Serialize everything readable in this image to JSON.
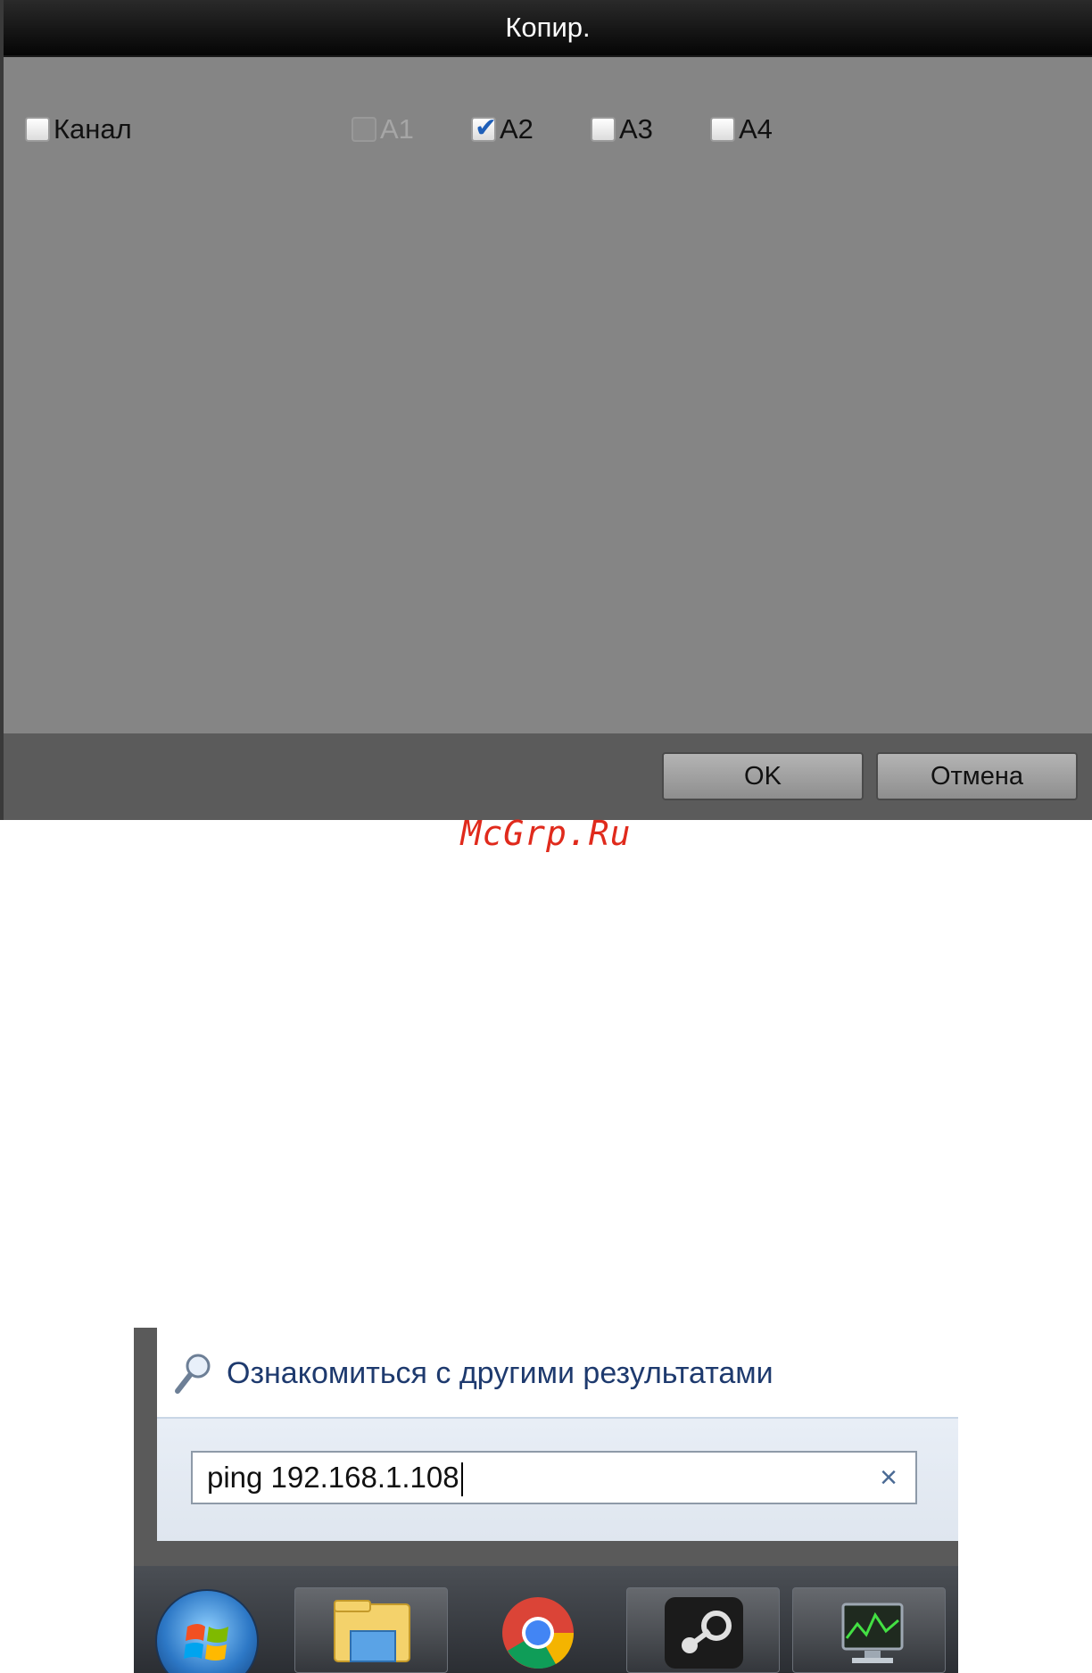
{
  "dialog": {
    "title": "Копир.",
    "channel_label": "Канал",
    "options": [
      {
        "label": "A1",
        "checked": false,
        "disabled": true
      },
      {
        "label": "A2",
        "checked": true,
        "disabled": false
      },
      {
        "label": "A3",
        "checked": false,
        "disabled": false
      },
      {
        "label": "A4",
        "checked": false,
        "disabled": false
      }
    ],
    "ok_label": "OK",
    "cancel_label": "Отмена"
  },
  "watermark": "McGrp.Ru",
  "startmenu": {
    "more_results": "Ознакомиться с другими результатами",
    "search_value": "ping 192.168.1.108",
    "clear_glyph": "×",
    "taskbar_icons": [
      "windows-start-orb",
      "file-explorer-icon",
      "chrome-icon",
      "steam-icon",
      "resource-monitor-icon"
    ]
  },
  "colors": {
    "dialog_bg": "#858585",
    "titlebar": "#0a0a0a",
    "footer": "#5b5b5b",
    "watermark": "#e02a1c",
    "check": "#1f5fb8"
  }
}
